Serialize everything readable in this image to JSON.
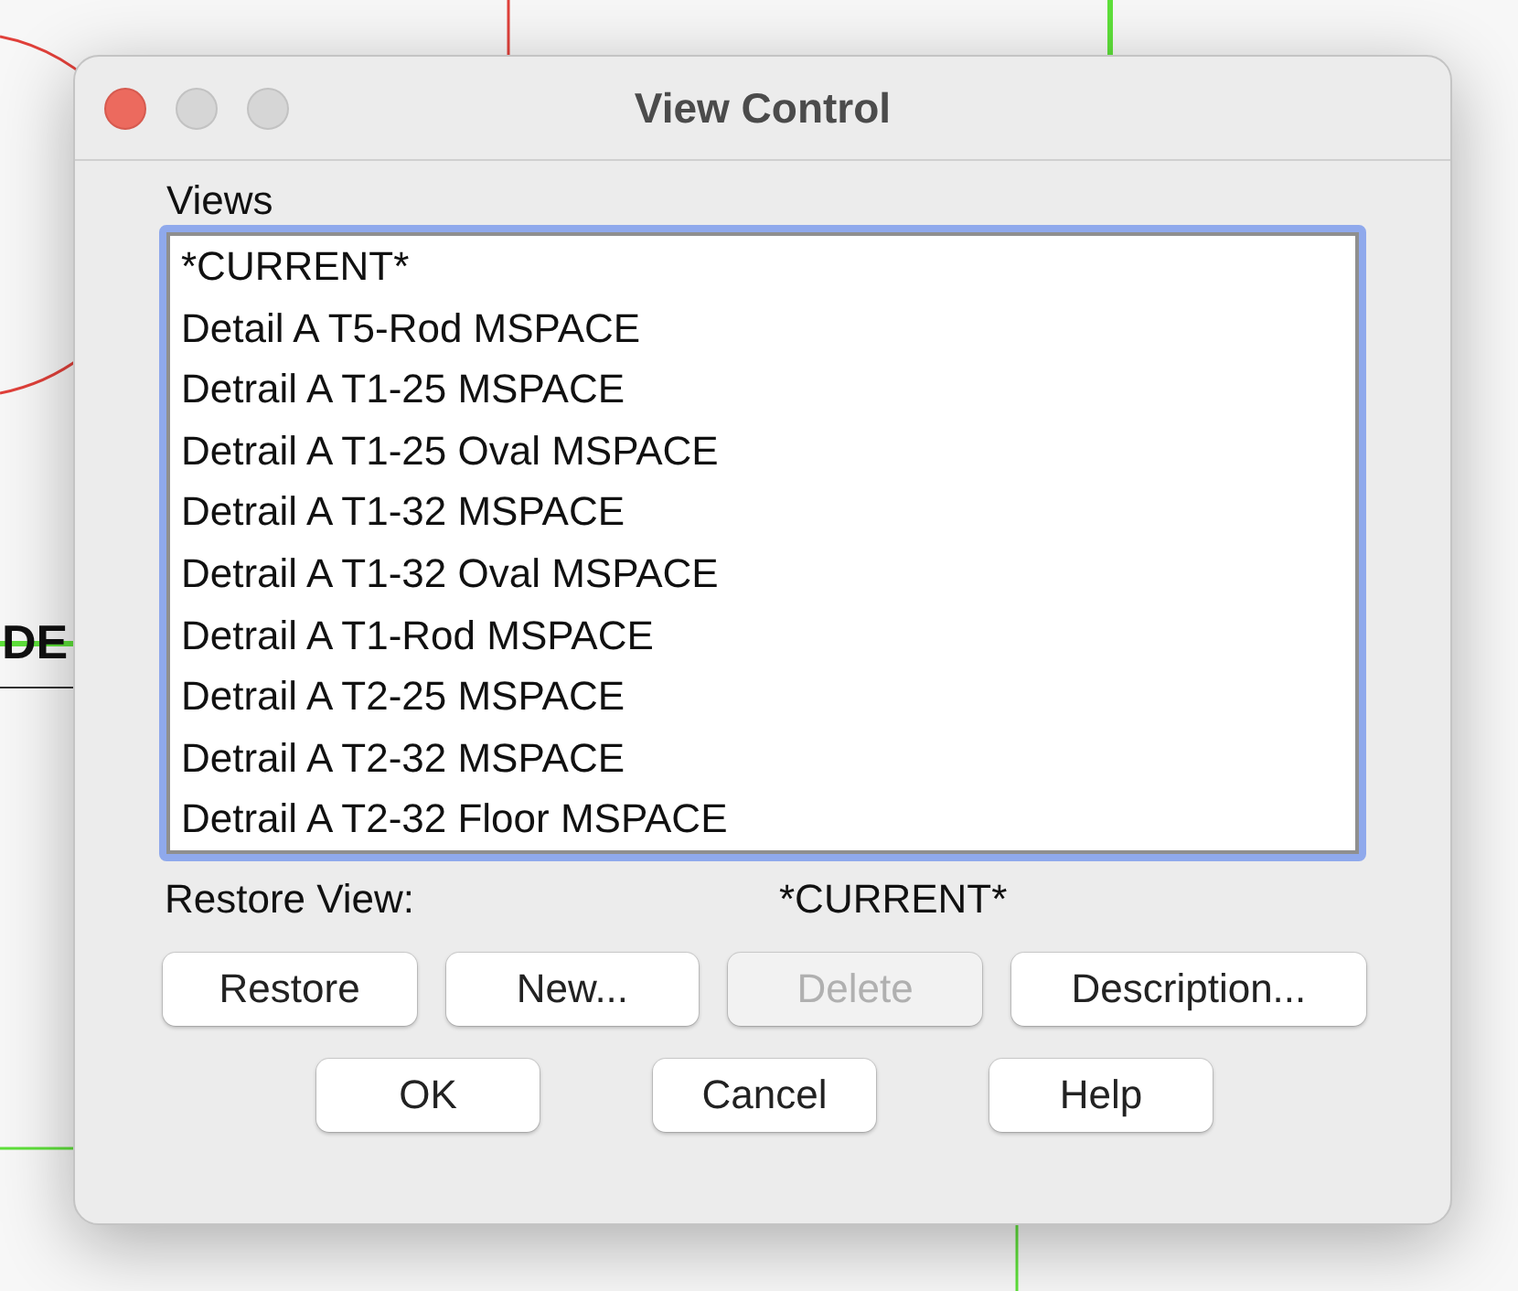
{
  "background": {
    "label": "DE"
  },
  "window": {
    "title": "View Control"
  },
  "views": {
    "label": "Views",
    "items": [
      {
        "name": "*CURRENT*",
        "selected": false
      },
      {
        "name": "Detail A T5-Rod MSPACE",
        "selected": false
      },
      {
        "name": "Detrail A T1-25 MSPACE",
        "selected": false
      },
      {
        "name": "Detrail A T1-25 Oval MSPACE",
        "selected": false
      },
      {
        "name": "Detrail A T1-32 MSPACE",
        "selected": false
      },
      {
        "name": "Detrail A T1-32 Oval MSPACE",
        "selected": false
      },
      {
        "name": "Detrail A T1-Rod MSPACE",
        "selected": false
      },
      {
        "name": "Detrail A T2-25 MSPACE",
        "selected": false
      },
      {
        "name": "Detrail A T2-32 MSPACE",
        "selected": false
      },
      {
        "name": "Detrail A T2-32 Floor MSPACE",
        "selected": false
      }
    ]
  },
  "restore_view": {
    "label": "Restore View:",
    "value": "*CURRENT*"
  },
  "action_buttons": [
    {
      "label": "Restore",
      "disabled": false
    },
    {
      "label": "New...",
      "disabled": false
    },
    {
      "label": "Delete",
      "disabled": true
    },
    {
      "label": "Description...",
      "disabled": false
    }
  ],
  "dialog_buttons": [
    {
      "label": "OK",
      "disabled": false
    },
    {
      "label": "Cancel",
      "disabled": false
    },
    {
      "label": "Help",
      "disabled": false
    }
  ]
}
